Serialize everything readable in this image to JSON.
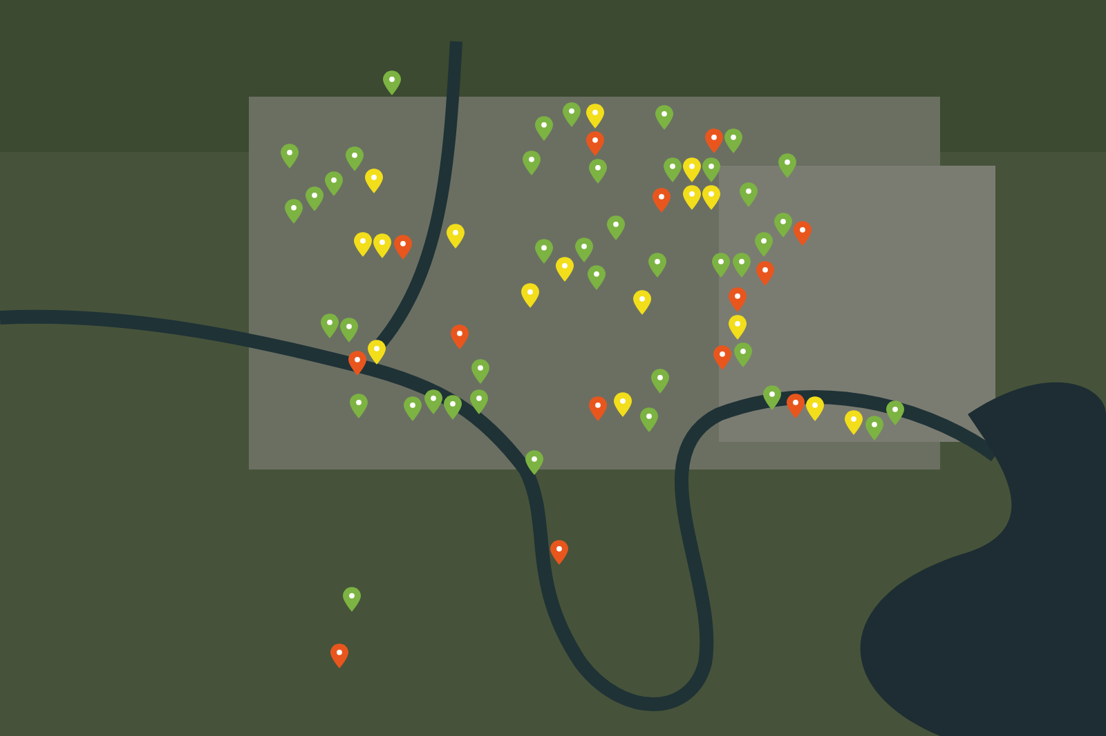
{
  "map": {
    "pins": [
      {
        "color": "#7cb342"
      },
      {
        "color": "#7cb342"
      },
      {
        "color": "#7cb342"
      },
      {
        "color": "#7cb342"
      },
      {
        "color": "#7cb342"
      },
      {
        "color": "#7cb342"
      },
      {
        "color": "#f2de1a"
      },
      {
        "color": "#f2de1a"
      },
      {
        "color": "#f2de1a"
      },
      {
        "color": "#e8561e"
      },
      {
        "color": "#f2de1a"
      },
      {
        "color": "#7cb342"
      },
      {
        "color": "#7cb342"
      },
      {
        "color": "#e8561e"
      },
      {
        "color": "#f2de1a"
      },
      {
        "color": "#e8561e"
      },
      {
        "color": "#7cb342"
      },
      {
        "color": "#7cb342"
      },
      {
        "color": "#7cb342"
      },
      {
        "color": "#7cb342"
      },
      {
        "color": "#7cb342"
      },
      {
        "color": "#7cb342"
      },
      {
        "color": "#7cb342"
      },
      {
        "color": "#f2de1a"
      },
      {
        "color": "#e8561e"
      },
      {
        "color": "#7cb342"
      },
      {
        "color": "#7cb342"
      },
      {
        "color": "#7cb342"
      },
      {
        "color": "#e8561e"
      },
      {
        "color": "#7cb342"
      },
      {
        "color": "#7cb342"
      },
      {
        "color": "#f2de1a"
      },
      {
        "color": "#7cb342"
      },
      {
        "color": "#7cb342"
      },
      {
        "color": "#f2de1a"
      },
      {
        "color": "#7cb342"
      },
      {
        "color": "#f2de1a"
      },
      {
        "color": "#7cb342"
      },
      {
        "color": "#e8561e"
      },
      {
        "color": "#f2de1a"
      },
      {
        "color": "#7cb342"
      },
      {
        "color": "#7cb342"
      },
      {
        "color": "#e8561e"
      },
      {
        "color": "#7cb342"
      },
      {
        "color": "#7cb342"
      },
      {
        "color": "#f2de1a"
      },
      {
        "color": "#7cb342"
      },
      {
        "color": "#f2de1a"
      },
      {
        "color": "#f2de1a"
      },
      {
        "color": "#7cb342"
      },
      {
        "color": "#7cb342"
      },
      {
        "color": "#7cb342"
      },
      {
        "color": "#e8561e"
      },
      {
        "color": "#7cb342"
      },
      {
        "color": "#7cb342"
      },
      {
        "color": "#7cb342"
      },
      {
        "color": "#e8561e"
      },
      {
        "color": "#e8561e"
      },
      {
        "color": "#f2de1a"
      },
      {
        "color": "#e8561e"
      },
      {
        "color": "#7cb342"
      },
      {
        "color": "#7cb342"
      },
      {
        "color": "#e8561e"
      },
      {
        "color": "#f2de1a"
      },
      {
        "color": "#f2de1a"
      },
      {
        "color": "#7cb342"
      },
      {
        "color": "#7cb342"
      },
      {
        "color": "#e8561e"
      },
      {
        "color": "#7cb342"
      },
      {
        "color": "#7cb342"
      },
      {
        "color": "#e8561e"
      }
    ]
  }
}
